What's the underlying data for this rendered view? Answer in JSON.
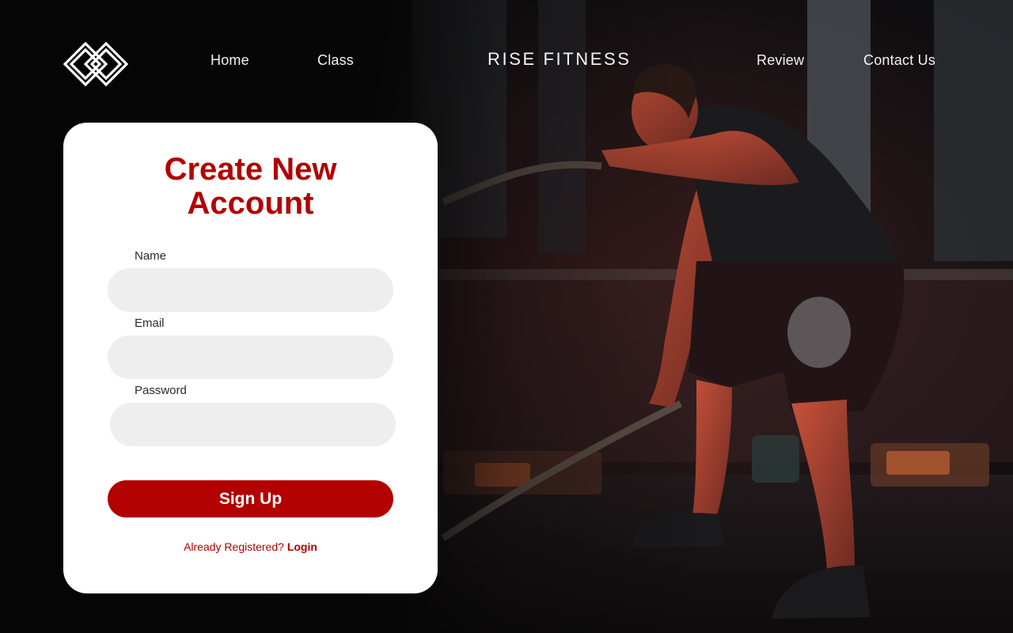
{
  "nav": {
    "logo_icon": "interlocked-diamond-logo-icon",
    "links": [
      "Home",
      "Class",
      "Review",
      "Contact Us"
    ],
    "brand": "RISE FITNESS"
  },
  "form": {
    "title_line1": "Create New",
    "title_line2": "Account",
    "name_label": "Name",
    "email_label": "Email",
    "password_label": "Password",
    "submit_label": "Sign Up",
    "already_text": "Already Registered?",
    "login_link": "Login"
  },
  "colors": {
    "accent": "#b30000",
    "card": "#ffffff",
    "input_bg": "#eeeeee",
    "background": "#050505"
  }
}
